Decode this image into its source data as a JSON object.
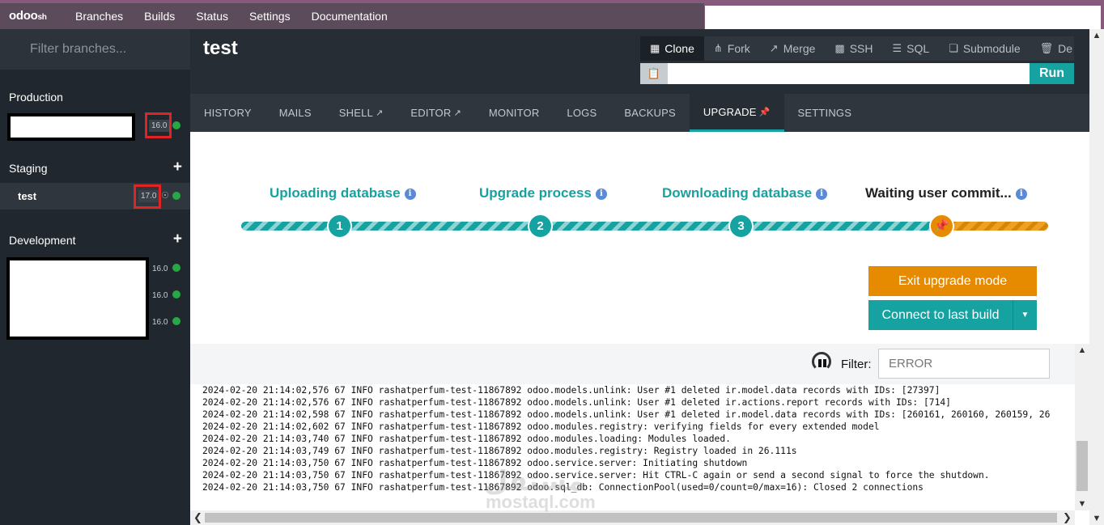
{
  "topbar": {
    "logo_main": "odoo",
    "logo_suffix": "sh",
    "nav": [
      "Branches",
      "Builds",
      "Status",
      "Settings",
      "Documentation"
    ]
  },
  "sidebar": {
    "filter_placeholder": "Filter branches...",
    "production": {
      "title": "Production",
      "version": "16.0"
    },
    "staging": {
      "title": "Staging",
      "branch_name": "test",
      "version": "17.0"
    },
    "development": {
      "title": "Development",
      "versions": [
        "16.0",
        "16.0",
        "16.0"
      ]
    }
  },
  "header": {
    "title": "test",
    "tools": [
      "Clone",
      "Fork",
      "Merge",
      "SSH",
      "SQL",
      "Submodule",
      "De"
    ],
    "run_label": "Run"
  },
  "tabs": [
    "HISTORY",
    "MAILS",
    "SHELL",
    "EDITOR",
    "MONITOR",
    "LOGS",
    "BACKUPS",
    "UPGRADE",
    "SETTINGS"
  ],
  "upgrade": {
    "steps": [
      "Uploading database",
      "Upgrade process",
      "Downloading database",
      "Waiting user commit..."
    ],
    "step_numbers": [
      "1",
      "2",
      "3"
    ],
    "exit_label": "Exit upgrade mode",
    "connect_label": "Connect to last build"
  },
  "logs": {
    "filter_label": "Filter:",
    "filter_value": "ERROR",
    "lines": [
      "2024-02-20 21:14:02,576 67 INFO rashatperfum-test-11867892 odoo.models.unlink: User #1 deleted ir.model.data records with IDs: [27397]",
      "2024-02-20 21:14:02,576 67 INFO rashatperfum-test-11867892 odoo.models.unlink: User #1 deleted ir.actions.report records with IDs: [714]",
      "2024-02-20 21:14:02,598 67 INFO rashatperfum-test-11867892 odoo.models.unlink: User #1 deleted ir.model.data records with IDs: [260161, 260160, 260159, 26",
      "2024-02-20 21:14:02,602 67 INFO rashatperfum-test-11867892 odoo.modules.registry: verifying fields for every extended model",
      "2024-02-20 21:14:03,740 67 INFO rashatperfum-test-11867892 odoo.modules.loading: Modules loaded.",
      "2024-02-20 21:14:03,749 67 INFO rashatperfum-test-11867892 odoo.modules.registry: Registry loaded in 26.111s",
      "2024-02-20 21:14:03,750 67 INFO rashatperfum-test-11867892 odoo.service.server: Initiating shutdown",
      "2024-02-20 21:14:03,750 67 INFO rashatperfum-test-11867892 odoo.service.server: Hit CTRL-C again or send a second signal to force the shutdown.",
      "2024-02-20 21:14:03,750 67 INFO rashatperfum-test-11867892 odoo.sql_db: ConnectionPool(used=0/count=0/max=16): Closed 2 connections"
    ]
  },
  "watermark": {
    "line1": "مستقل",
    "line2": "mostaql.com"
  }
}
